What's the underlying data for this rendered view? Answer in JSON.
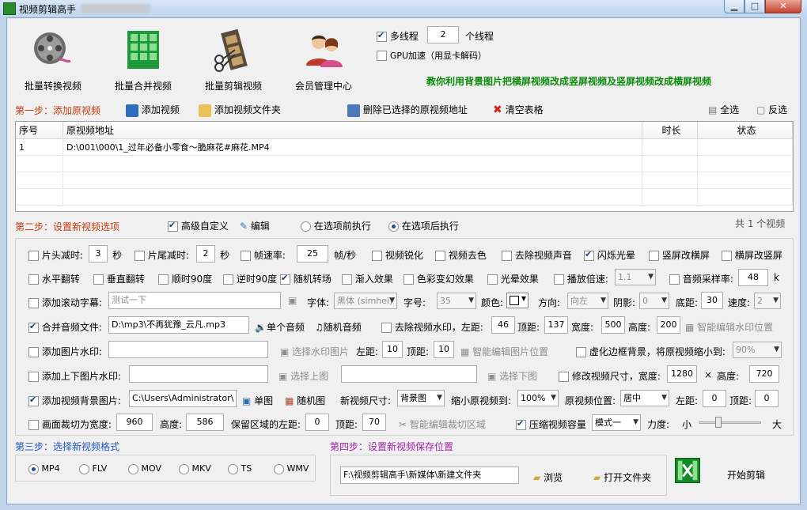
{
  "window": {
    "title": "视频剪辑高手",
    "min_icon": "minimize-icon",
    "max_icon": "maximize-icon",
    "close_icon": "close-icon"
  },
  "toolbar": {
    "items": [
      {
        "label": "批量转换视频",
        "icon": "film-reel-icon"
      },
      {
        "label": "批量合并视频",
        "icon": "merge-grid-icon"
      },
      {
        "label": "批量剪辑视频",
        "icon": "film-scissors-icon"
      },
      {
        "label": "会员管理中心",
        "icon": "users-icon"
      }
    ],
    "multithread_label": "多线程",
    "multithread_checked": true,
    "thread_count": "2",
    "thread_unit": "个线程",
    "gpu_label": "GPU加速（用显卡解码）",
    "gpu_checked": false,
    "promo": "教你利用背景图片把横屏视频改成竖屏视频及竖屏视频改成横屏视频"
  },
  "step1": {
    "title": "第一步：添加原视频",
    "add_video": "添加视频",
    "add_folder": "添加视频文件夹",
    "delete_selected": "删除已选择的原视频地址",
    "clear_table": "清空表格",
    "select_all": "全选",
    "invert": "反选"
  },
  "table": {
    "headers": [
      "序号",
      "原视频地址",
      "时长",
      "状态"
    ],
    "rows": [
      {
        "index": "1",
        "path": "D:\\001\\000\\1_过年必备小零食～脆麻花#麻花.MP4",
        "duration": "",
        "status": ""
      }
    ]
  },
  "step2": {
    "title": "第二步：设置新视频选项",
    "advanced_label": "高级自定义",
    "advanced_checked": true,
    "edit_label": "编辑",
    "before_label": "在选项前执行",
    "after_label": "在选项后执行",
    "count_text": "共 1 个视频"
  },
  "options": {
    "head_cut": {
      "label": "片头减时:",
      "value": "3",
      "unit": "秒"
    },
    "tail_cut": {
      "label": "片尾减时:",
      "value": "2",
      "unit": "秒"
    },
    "framerate": {
      "label": "帧速率:",
      "value": "25",
      "unit": "帧/秒"
    },
    "sharpen": "视频锐化",
    "decolor": "视频去色",
    "remove_audio": "去除视频声音",
    "flash": "闪烁光晕",
    "v2h": "竖屏改横屏",
    "h2v": "横屏改竖屏",
    "hflip": "水平翻转",
    "vflip": "垂直翻转",
    "rot_cw": "顺时90度",
    "rot_ccw": "逆时90度",
    "random_trans": "随机转场",
    "fade_in": "渐入效果",
    "color_change": "色彩变幻效果",
    "halo": "光晕效果",
    "speed": {
      "label": "播放倍速:",
      "value": "1.1"
    },
    "samplerate": {
      "label": "音频采样率:",
      "value": "48",
      "unit": "k"
    },
    "subtitle": {
      "label": "添加滚动字幕:",
      "value": "测试一下",
      "font_label": "字体:",
      "font_value": "黑体 (simhei)",
      "size_label": "字号:",
      "size_value": "35",
      "color_label": "颜色:",
      "dir_label": "方向:",
      "dir_value": "向左",
      "shadow_label": "阴影:",
      "shadow_value": "0",
      "bottom_label": "底距:",
      "bottom_value": "30",
      "speed_label": "速度:",
      "speed_value": "2"
    },
    "merge_audio": {
      "label": "合并音频文件:",
      "value": "D:\\mp3\\不再犹豫_云凡.mp3",
      "single": "单个音频",
      "random": "随机音频"
    },
    "remove_watermark": {
      "label": "去除视频水印，左距:",
      "left": "46",
      "top_label": "顶距:",
      "top": "137",
      "width_label": "宽度:",
      "width": "500",
      "height_label": "高度:",
      "height": "200",
      "smart": "智能编辑水印位置"
    },
    "image_watermark": {
      "label": "添加图片水印:",
      "choose": "选择水印图片",
      "left_label": "左距:",
      "left": "10",
      "top_label": "顶距:",
      "top": "10",
      "smart": "智能编辑图片位置"
    },
    "blur_border": {
      "label": "虚化边框背景，将原视频缩小到:",
      "value": "90%"
    },
    "topbottom": {
      "label": "添加上下图片水印:",
      "top_btn": "选择上图",
      "bottom_btn": "选择下图"
    },
    "resize": {
      "label": "修改视频尺寸，宽度:",
      "width": "1280",
      "x": "×",
      "height_label": "高度:",
      "height": "720"
    },
    "bg_image": {
      "label": "添加视频背景图片:",
      "value": "C:\\Users\\Administrator\\",
      "single": "单图",
      "random": "随机图",
      "size_label": "新视频尺寸:",
      "size_value": "背景图",
      "shrink_label": "缩小原视频到:",
      "shrink_value": "100%",
      "pos_label": "原视频位置:",
      "pos_value": "居中",
      "left_label": "左距:",
      "left": "0",
      "top_label": "顶距:",
      "top": "0"
    },
    "crop": {
      "label": "画面裁切为宽度:",
      "width": "960",
      "height_label": "高度:",
      "height": "586",
      "keep_left_label": "保留区域的左距:",
      "left": "0",
      "top_label": "顶距:",
      "top": "70",
      "smart": "智能编辑裁切区域"
    },
    "compress": {
      "label": "压缩视频容量",
      "mode": "模式一",
      "strength_label": "力度:",
      "small": "小",
      "big": "大",
      "level": 0.28
    }
  },
  "step3": {
    "title": "第三步：选择新视频格式",
    "formats": [
      {
        "label": "MP4",
        "selected": true
      },
      {
        "label": "FLV",
        "selected": false
      },
      {
        "label": "MOV",
        "selected": false
      },
      {
        "label": "MKV",
        "selected": false
      },
      {
        "label": "TS",
        "selected": false
      },
      {
        "label": "WMV",
        "selected": false
      }
    ]
  },
  "step4": {
    "title": "第四步：设置新视频保存位置",
    "path": "F:\\视频剪辑高手\\新媒体\\新建文件夹",
    "browse": "浏览",
    "open_folder": "打开文件夹",
    "start": "开始剪辑"
  },
  "colors": {
    "accent_green": "#0a8a0a",
    "step_red": "#c63b0e",
    "step_blue": "#1f57c5",
    "step_purple": "#a321a9"
  }
}
